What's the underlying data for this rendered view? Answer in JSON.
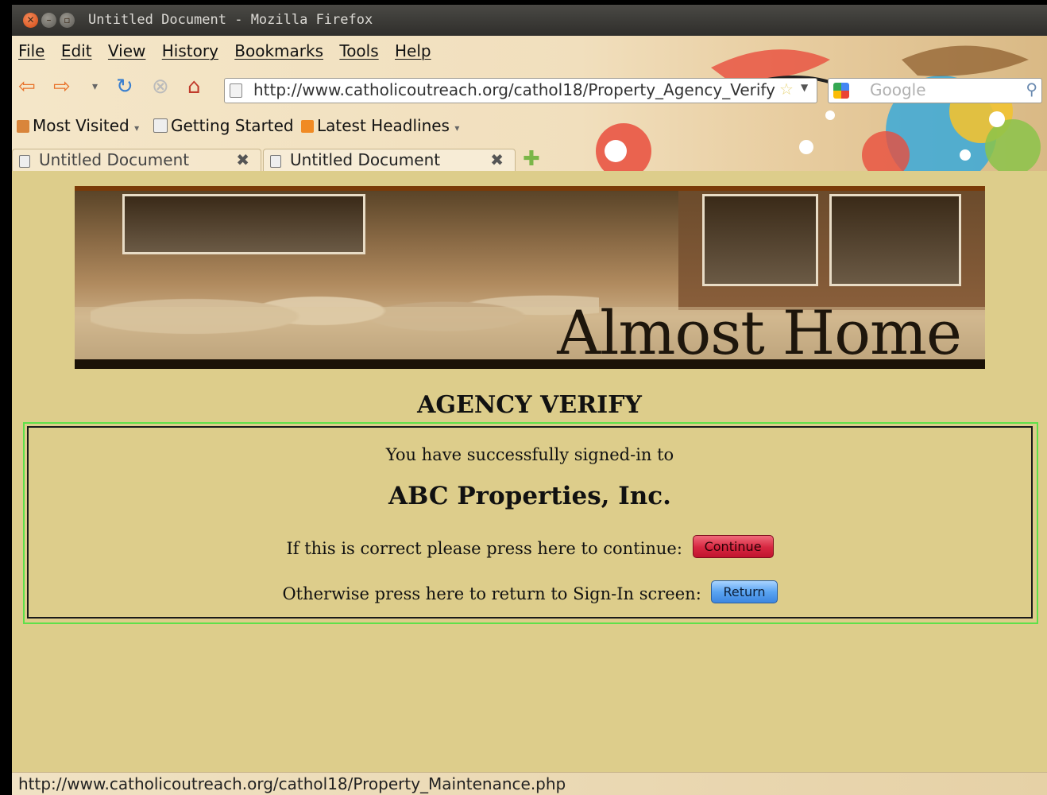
{
  "window": {
    "title": "Untitled Document - Mozilla Firefox"
  },
  "menu": [
    "File",
    "Edit",
    "View",
    "History",
    "Bookmarks",
    "Tools",
    "Help"
  ],
  "navbar": {
    "url": "http://www.catholicoutreach.org/cathol18/Property_Agency_Verify",
    "search_placeholder": "Google"
  },
  "bookmarks": [
    "Most Visited",
    "Getting Started",
    "Latest Headlines"
  ],
  "tabs": [
    {
      "label": "Untitled Document",
      "active": false
    },
    {
      "label": "Untitled Document",
      "active": true
    }
  ],
  "banner": {
    "title": "Almost Home"
  },
  "page": {
    "heading": "AGENCY VERIFY",
    "signed_in_text": "You have successfully signed-in to",
    "company": "ABC Properties, Inc.",
    "continue_prompt": "If this is correct please press here to continue:",
    "continue_label": "Continue",
    "return_prompt": "Otherwise press here to return to Sign-In screen:",
    "return_label": "Return"
  },
  "status": {
    "text": "http://www.catholicoutreach.org/cathol18/Property_Maintenance.php"
  },
  "colors": {
    "page_bg": "#ddcd8b",
    "panel_border": "#5fe04a",
    "continue_button": "#d62640",
    "return_button": "#5aa4f2"
  }
}
